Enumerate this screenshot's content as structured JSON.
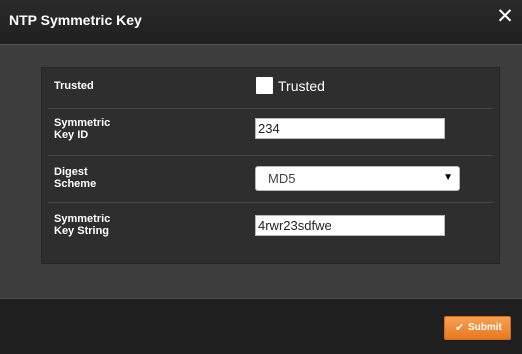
{
  "dialog": {
    "title": "NTP Symmetric Key",
    "close_glyph": "✕"
  },
  "form": {
    "trusted": {
      "label": "Trusted",
      "checkbox_label": "Trusted",
      "checked": false
    },
    "key_id": {
      "label_line1": "Symmetric",
      "label_line2": "Key ID",
      "value": "234"
    },
    "digest_scheme": {
      "label_line1": "Digest",
      "label_line2": "Scheme",
      "selected": "MD5"
    },
    "key_string": {
      "label_line1": "Symmetric",
      "label_line2": "Key String",
      "value": "4rwr23sdfwe"
    }
  },
  "footer": {
    "submit_label": "Submit",
    "submit_icon": "check-icon"
  },
  "colors": {
    "accent": "#f0862f",
    "titlebar": "#222222",
    "panel": "#2e2e2e"
  }
}
